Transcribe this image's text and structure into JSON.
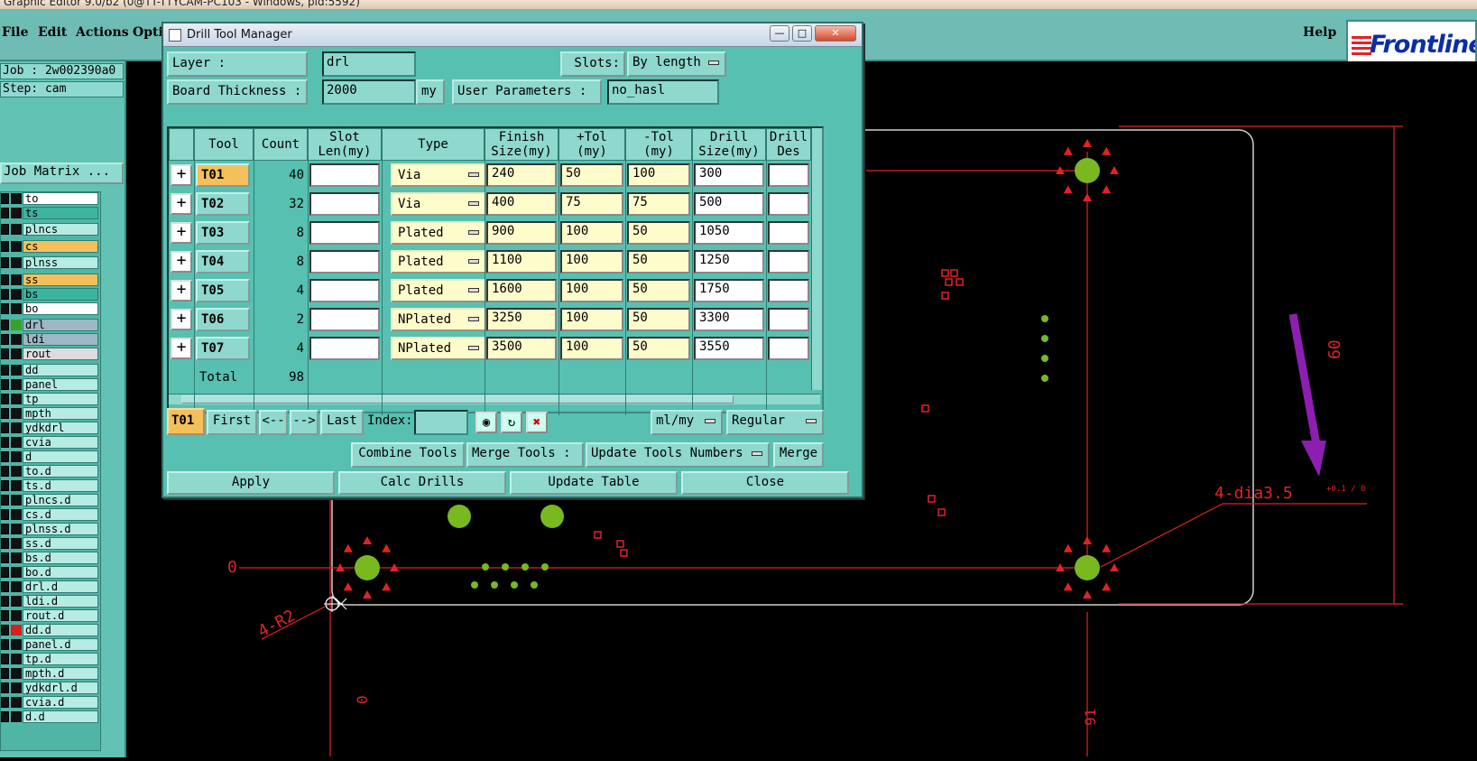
{
  "app_title": "Graphic Editor 9.0/b2 (0@TT-TTYCAM-PC103 - Windows, pid:5592)",
  "menu": {
    "file": "File",
    "edit": "Edit",
    "actions": "Actions",
    "options": "Opti",
    "help": "Help"
  },
  "brand": "Frontline",
  "sidebar": {
    "job_label": "Job : 2w002390a0",
    "step_label": "Step: cam",
    "job_matrix": "Job Matrix ...",
    "layers": [
      "to",
      "ts",
      "plncs",
      "cs",
      "plnss",
      "ss",
      "bs",
      "bo",
      "drl",
      "ldi",
      "rout",
      "dd",
      "panel",
      "tp",
      "mpth",
      "ydkdrl",
      "cvia",
      "d",
      "to.d",
      "ts.d",
      "plncs.d",
      "cs.d",
      "plnss.d",
      "ss.d",
      "bs.d",
      "bo.d",
      "drl.d",
      "ldi.d",
      "rout.d",
      "dd.d",
      "panel.d",
      "tp.d",
      "mpth.d",
      "ydkdrl.d",
      "cvia.d",
      "d.d"
    ]
  },
  "dialog": {
    "title": "Drill Tool Manager",
    "layer_label": "Layer          :",
    "layer_value": "drl",
    "slots_label": "Slots:",
    "slots_value": "By length",
    "thickness_label": "Board Thickness :",
    "thickness_value": "2000",
    "thickness_unit": "my",
    "user_params_label": "User Parameters :",
    "user_params_value": "no_hasl",
    "columns": [
      "Tool",
      "Count",
      "Slot\nLen(my)",
      "Type",
      "Finish\nSize(my)",
      "+Tol\n(my)",
      "-Tol\n(my)",
      "Drill\nSize(my)",
      "Drill\nDes"
    ],
    "rows": [
      {
        "tool": "T01",
        "count": "40",
        "slot": "",
        "type": "Via",
        "finish": "240",
        "ptol": "50",
        "mtol": "100",
        "drill": "300",
        "des": ""
      },
      {
        "tool": "T02",
        "count": "32",
        "slot": "",
        "type": "Via",
        "finish": "400",
        "ptol": "75",
        "mtol": "75",
        "drill": "500",
        "des": ""
      },
      {
        "tool": "T03",
        "count": "8",
        "slot": "",
        "type": "Plated",
        "finish": "900",
        "ptol": "100",
        "mtol": "50",
        "drill": "1050",
        "des": ""
      },
      {
        "tool": "T04",
        "count": "8",
        "slot": "",
        "type": "Plated",
        "finish": "1100",
        "ptol": "100",
        "mtol": "50",
        "drill": "1250",
        "des": ""
      },
      {
        "tool": "T05",
        "count": "4",
        "slot": "",
        "type": "Plated",
        "finish": "1600",
        "ptol": "100",
        "mtol": "50",
        "drill": "1750",
        "des": ""
      },
      {
        "tool": "T06",
        "count": "2",
        "slot": "",
        "type": "NPlated",
        "finish": "3250",
        "ptol": "100",
        "mtol": "50",
        "drill": "3300",
        "des": ""
      },
      {
        "tool": "T07",
        "count": "4",
        "slot": "",
        "type": "NPlated",
        "finish": "3500",
        "ptol": "100",
        "mtol": "50",
        "drill": "3550",
        "des": ""
      }
    ],
    "total_label": "Total",
    "total_count": "98",
    "current_tool": "T01",
    "nav": {
      "first": "First",
      "prev": "<--",
      "next": "-->",
      "last": "Last",
      "index_label": "Index:"
    },
    "units_value": "ml/my",
    "mode_value": "Regular",
    "combine_tools": "Combine Tools",
    "merge_tools_label": "Merge Tools :",
    "merge_option": "Update Tools Numbers",
    "merge_button": "Merge",
    "apply": "Apply",
    "calc_drills": "Calc Drills",
    "update_table": "Update Table",
    "close": "Close"
  },
  "drawing": {
    "dim_0_left": "0",
    "dim_0_bottom": "0",
    "dim_60": "60",
    "dim_91": "91",
    "radius_note": "4-R2",
    "hole_note": "4-dia3.5",
    "hole_tol": "+0.1 / 0"
  },
  "colors": {
    "accent": "#58c0b1",
    "highlight": "#f4c05c",
    "annotation": "#e42222",
    "arrow": "#b23ed0"
  }
}
